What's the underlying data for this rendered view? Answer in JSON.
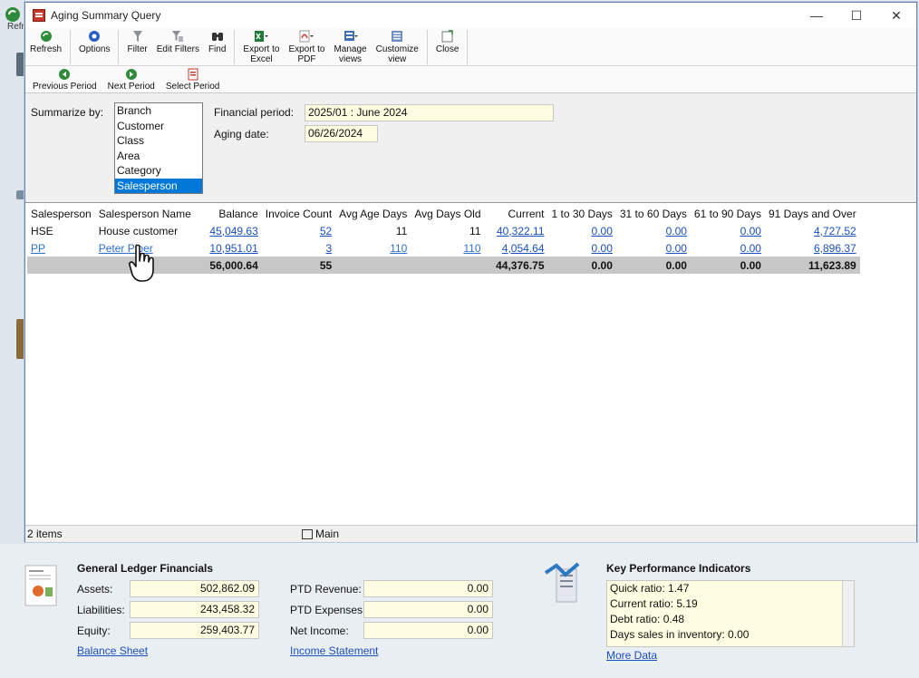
{
  "background": {
    "app_label": "Refr"
  },
  "window": {
    "title": "Aging Summary Query",
    "controls": {
      "minimize": "—",
      "maximize": "☐",
      "close": "✕"
    }
  },
  "toolbar": {
    "refresh": "Refresh",
    "options": "Options",
    "filter": "Filter",
    "edit_filters": "Edit Filters",
    "find": "Find",
    "export_excel_1": "Export to",
    "export_excel_2": "Excel",
    "export_pdf_1": "Export to",
    "export_pdf_2": "PDF",
    "manage_views_1": "Manage",
    "manage_views_2": "views",
    "customize_view_1": "Customize",
    "customize_view_2": "view",
    "close": "Close"
  },
  "period_toolbar": {
    "previous": "Previous Period",
    "next": "Next Period",
    "select": "Select Period"
  },
  "criteria": {
    "summarize_label": "Summarize by:",
    "summarize_options": [
      "Branch",
      "Customer",
      "Class",
      "Area",
      "Category",
      "Salesperson"
    ],
    "selected": "Salesperson",
    "financial_period_label": "Financial period:",
    "financial_period_value": "2025/01 : June 2024",
    "aging_date_label": "Aging date:",
    "aging_date_value": "06/26/2024"
  },
  "grid": {
    "columns": [
      "Salesperson",
      "Salesperson Name",
      "Balance",
      "Invoice Count",
      "Avg Age Days",
      "Avg Days Old",
      "Current",
      "1 to 30 Days",
      "31 to 60 Days",
      "61 to 90 Days",
      "91 Days and Over"
    ],
    "rows": [
      [
        "HSE",
        "House customer",
        "45,049.63",
        "52",
        "11",
        "11",
        "40,322.11",
        "0.00",
        "0.00",
        "0.00",
        "4,727.52"
      ],
      [
        "PP",
        "Peter Piper",
        "10,951.01",
        "3",
        "110",
        "110",
        "4,054.64",
        "0.00",
        "0.00",
        "0.00",
        "6,896.37"
      ]
    ],
    "totals": [
      "",
      "",
      "56,000.64",
      "55",
      "",
      "",
      "44,376.75",
      "0.00",
      "0.00",
      "0.00",
      "11,623.89"
    ]
  },
  "status": {
    "items": "2 items",
    "view": "Main"
  },
  "gl": {
    "title": "General Ledger Financials",
    "assets_label": "Assets:",
    "assets": "502,862.09",
    "liabilities_label": "Liabilities:",
    "liabilities": "243,458.32",
    "equity_label": "Equity:",
    "equity": "259,403.77",
    "ptd_revenue_label": "PTD Revenue:",
    "ptd_revenue": "0.00",
    "ptd_expenses_label": "PTD Expenses:",
    "ptd_expenses": "0.00",
    "net_income_label": "Net Income:",
    "net_income": "0.00",
    "balance_sheet_link": "Balance Sheet",
    "income_statement_link": "Income Statement"
  },
  "kpi": {
    "title": "Key Performance Indicators",
    "lines": [
      "Quick ratio: 1.47",
      "Current ratio: 5.19",
      "Debt ratio: 0.48",
      "Days sales in inventory: 0.00"
    ],
    "more_link": "More Data"
  },
  "colors": {
    "link": "#1a4fbf",
    "selection": "#0078d7",
    "field_bg": "#fffde1",
    "total_row": "#c7c7c7"
  }
}
